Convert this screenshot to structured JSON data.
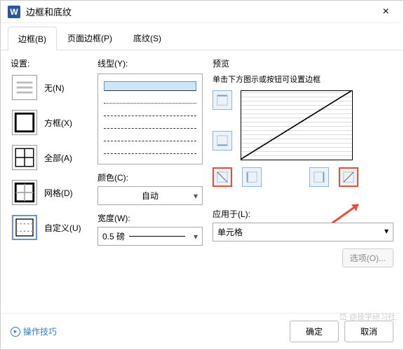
{
  "dialog": {
    "app_icon": "W",
    "title": "边框和底纹",
    "close": "×"
  },
  "tabs": {
    "borders": "边框(B)",
    "page_borders": "页面边框(P)",
    "shading": "底纹(S)"
  },
  "settings": {
    "label": "设置:",
    "none": "无(N)",
    "box": "方框(X)",
    "all": "全部(A)",
    "grid": "网格(D)",
    "custom": "自定义(U)"
  },
  "style": {
    "label": "线型(Y):"
  },
  "color": {
    "label": "颜色(C):",
    "value": "自动"
  },
  "width": {
    "label": "宽度(W):",
    "value": "0.5  磅"
  },
  "preview": {
    "label": "预览",
    "hint": "单击下方图示或按钮可设置边框"
  },
  "apply": {
    "label": "应用于(L):",
    "value": "单元格"
  },
  "options_btn": "选项(O)...",
  "footer": {
    "tips": "操作技巧",
    "ok": "确定",
    "cancel": "取消"
  },
  "watermark": "岱 @技学研习社"
}
